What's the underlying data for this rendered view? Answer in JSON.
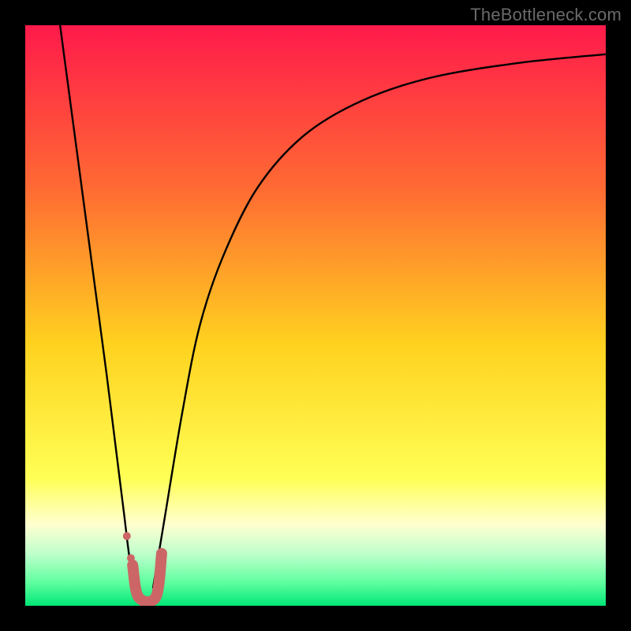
{
  "watermark": "TheBottleneck.com",
  "chart_data": {
    "type": "line",
    "title": "",
    "xlabel": "",
    "ylabel": "",
    "xlim": [
      0,
      100
    ],
    "ylim": [
      0,
      100
    ],
    "grid": false,
    "legend": false,
    "gradient_stops": [
      {
        "offset": 0.0,
        "color": "#ff1a4b"
      },
      {
        "offset": 0.28,
        "color": "#ff6a33"
      },
      {
        "offset": 0.55,
        "color": "#ffd21f"
      },
      {
        "offset": 0.78,
        "color": "#ffff55"
      },
      {
        "offset": 0.86,
        "color": "#ffffd0"
      },
      {
        "offset": 0.91,
        "color": "#bfffcc"
      },
      {
        "offset": 0.96,
        "color": "#5fff9f"
      },
      {
        "offset": 1.0,
        "color": "#00e676"
      }
    ],
    "series": [
      {
        "name": "left-branch",
        "stroke": "#000000",
        "stroke_width": 2.4,
        "points": [
          {
            "x": 6.0,
            "y": 100.0
          },
          {
            "x": 8.0,
            "y": 85.0
          },
          {
            "x": 10.0,
            "y": 70.0
          },
          {
            "x": 12.0,
            "y": 55.0
          },
          {
            "x": 14.0,
            "y": 40.0
          },
          {
            "x": 15.5,
            "y": 28.0
          },
          {
            "x": 17.0,
            "y": 16.0
          },
          {
            "x": 18.0,
            "y": 8.0
          },
          {
            "x": 19.0,
            "y": 3.0
          }
        ]
      },
      {
        "name": "right-branch",
        "stroke": "#000000",
        "stroke_width": 2.4,
        "points": [
          {
            "x": 22.0,
            "y": 3.0
          },
          {
            "x": 24.0,
            "y": 15.0
          },
          {
            "x": 27.0,
            "y": 33.0
          },
          {
            "x": 30.0,
            "y": 48.0
          },
          {
            "x": 34.0,
            "y": 60.0
          },
          {
            "x": 40.0,
            "y": 72.0
          },
          {
            "x": 48.0,
            "y": 81.0
          },
          {
            "x": 58.0,
            "y": 87.0
          },
          {
            "x": 70.0,
            "y": 91.0
          },
          {
            "x": 85.0,
            "y": 93.5
          },
          {
            "x": 100.0,
            "y": 95.0
          }
        ]
      },
      {
        "name": "marker-path",
        "stroke": "#cc6666",
        "stroke_width": 14,
        "linecap": "round",
        "points": [
          {
            "x": 18.5,
            "y": 7.0
          },
          {
            "x": 19.5,
            "y": 1.5
          },
          {
            "x": 22.5,
            "y": 1.5
          },
          {
            "x": 23.5,
            "y": 9.0
          }
        ]
      }
    ],
    "marker_dots": [
      {
        "x": 17.5,
        "y": 12.0,
        "r": 5,
        "fill": "#cc6666"
      },
      {
        "x": 18.2,
        "y": 8.2,
        "r": 5,
        "fill": "#cc6666"
      }
    ]
  }
}
